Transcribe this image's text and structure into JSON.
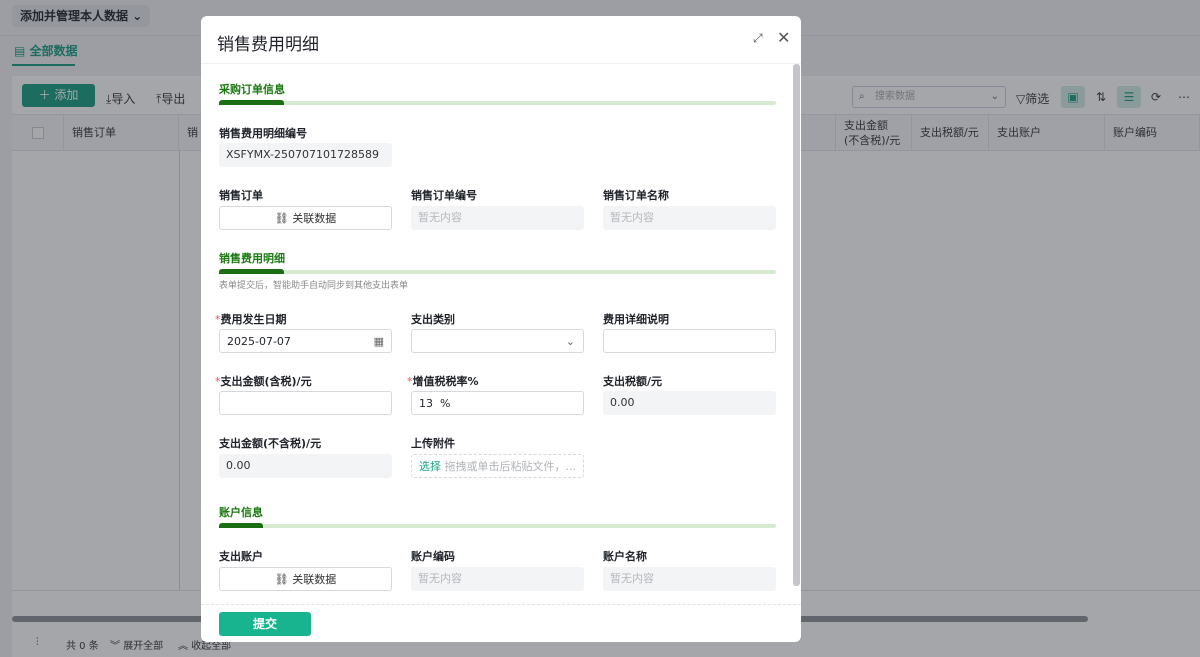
{
  "page": {
    "view_select": "添加并管理本人数据",
    "tab": "全部数据",
    "toolbar": {
      "add": "添加",
      "import": "导入",
      "export": "导出",
      "search_placeholder": "搜索数据",
      "filter": "筛选"
    },
    "columns_left": [
      "销售订单",
      "销"
    ],
    "columns_right": [
      "支出金额(不含税)/元",
      "支出税额/元",
      "支出账户",
      "账户编码"
    ],
    "footer": {
      "total": "共 0 条",
      "expand": "展开全部",
      "collapse": "收起全部"
    }
  },
  "modal": {
    "title": "销售费用明细",
    "sections": {
      "s1": "采购订单信息",
      "s2": "销售费用明细",
      "s2_hint": "表单提交后，智能助手自动同步到其他支出表单",
      "s3": "账户信息"
    },
    "fields": {
      "code_label": "销售费用明细编号",
      "code_value": "XSFYMX-250707101728589",
      "order_label": "销售订单",
      "order_btn": "关联数据",
      "order_no_label": "销售订单编号",
      "order_name_label": "销售订单名称",
      "empty": "暂无内容",
      "date_label": "费用发生日期",
      "date_value": "2025-07-07",
      "category_label": "支出类别",
      "desc_label": "费用详细说明",
      "amount_label": "支出金额(含税)/元",
      "rate_label": "增值税税率%",
      "rate_value": "13  %",
      "tax_label": "支出税额/元",
      "tax_value": "0.00",
      "net_label": "支出金额(不含税)/元",
      "net_value": "0.00",
      "upload_label": "上传附件",
      "upload_select": "选择",
      "upload_hint": "拖拽或单击后粘贴文件，...",
      "account_label": "支出账户",
      "account_btn": "关联数据",
      "account_code_label": "账户编码",
      "account_name_label": "账户名称"
    },
    "submit": "提交"
  },
  "colors": {
    "accent": "#149c7e",
    "section": "#1c7a12",
    "submit": "#17b48f"
  }
}
